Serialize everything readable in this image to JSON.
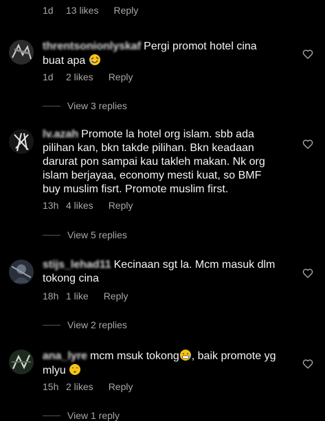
{
  "top_meta": {
    "time": "1d",
    "likes": "13 likes",
    "reply": "Reply"
  },
  "comments": [
    {
      "username": "threntsonionlyskaf",
      "text": "Pergi promot hotel cina buat apa",
      "emoji": "rofl",
      "time": "1d",
      "likes": "2 likes",
      "reply": "Reply",
      "view_replies": "View 3 replies"
    },
    {
      "username": "lv.azah",
      "text": "Promote la hotel org islam. sbb ada pilihan kan, bkn takde pilihan. Bkn keadaan darurat pon sampai kau takleh makan. Nk org islam berjayaa, economy mesti kuat, so BMF buy muslim fisrt. Promote muslim first.",
      "time": "13h",
      "likes": "4 likes",
      "reply": "Reply",
      "view_replies": "View 5 replies"
    },
    {
      "username": "stijs_lehad11",
      "text": "Kecinaan sgt la. Mcm masuk dlm tokong cina",
      "time": "18h",
      "likes": "1 like",
      "reply": "Reply",
      "view_replies": "View 2 replies"
    },
    {
      "username": "ana_lyre",
      "text": "mcm msuk tokong",
      "text_after": ", baik promote yg mlyu",
      "emoji": "grimace",
      "emoji2": "shush",
      "time": "15h",
      "likes": "2 likes",
      "reply": "Reply",
      "view_replies": "View 1 reply"
    }
  ],
  "colors": {
    "background": "#000000",
    "text": "#f5f5f5",
    "muted": "#a8a8a8"
  },
  "icons": {
    "heart": "heart-outline-icon"
  }
}
